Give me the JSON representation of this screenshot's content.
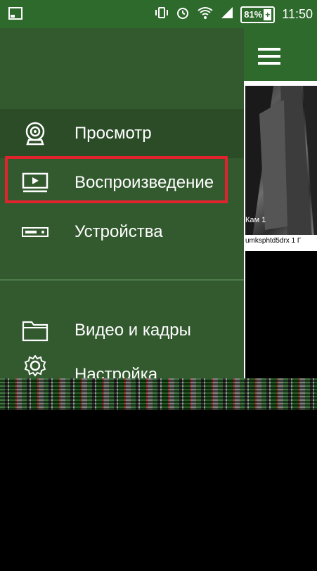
{
  "status_bar": {
    "battery_percent": "81%",
    "battery_plus": "+",
    "time": "11:50",
    "icons": [
      "screenshot-icon",
      "vibrate-icon",
      "alarm-icon",
      "wifi-icon",
      "signal-icon",
      "battery-icon"
    ]
  },
  "drawer": {
    "items": [
      {
        "label": "Просмотр",
        "icon": "webcam-icon"
      },
      {
        "label": "Воспроизведение",
        "icon": "playback-icon"
      },
      {
        "label": "Устройства",
        "icon": "dvr-device-icon"
      },
      {
        "label": "Видео и кадры",
        "icon": "folder-icon"
      },
      {
        "label": "Настройка",
        "icon": "gear-icon"
      }
    ]
  },
  "content": {
    "camera_name": "Кам 1",
    "camera_caption": "umksphtd5drx 1 Г"
  },
  "colors": {
    "accent": "#2d6a2c",
    "drawer_bg": "#335a2f",
    "highlight_border": "#e0232d"
  }
}
